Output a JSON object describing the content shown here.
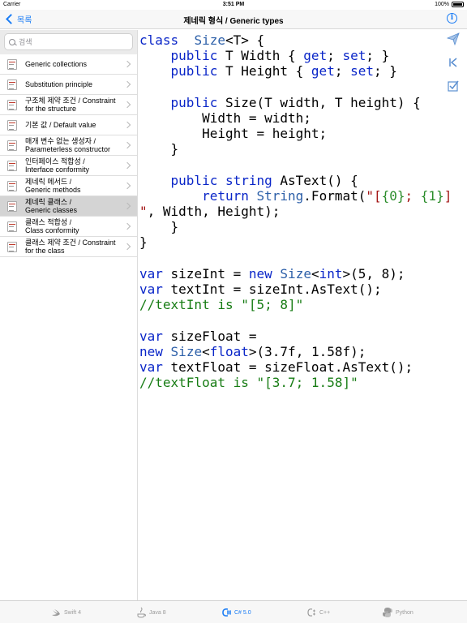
{
  "status": {
    "carrier": "Carrier",
    "time": "3:51 PM",
    "battery": "100%"
  },
  "nav": {
    "back_label": "목록",
    "title": "제네릭 형식 / Generic types",
    "info_glyph": "i"
  },
  "search": {
    "placeholder": "검색"
  },
  "sidebar": {
    "items": [
      {
        "line1": "Generic collections",
        "line2": ""
      },
      {
        "line1": "Substitution principle",
        "line2": ""
      },
      {
        "line1": "구조체 제약 조건 / Constraint",
        "line2": "for the structure"
      },
      {
        "line1": "기본 값 / Default value",
        "line2": ""
      },
      {
        "line1": "매개 변수 없는 생성자 /",
        "line2": "Parameterless constructor"
      },
      {
        "line1": "인터페이스 적합성 /",
        "line2": "Interface conformity"
      },
      {
        "line1": "제네릭 메서드 /",
        "line2": "Generic methods"
      },
      {
        "line1": "제네릭 클래스 /",
        "line2": "Generic classes"
      },
      {
        "line1": "클래스 적합성 /",
        "line2": "Class conformity"
      },
      {
        "line1": "클래스 제약 조건 / Constraint",
        "line2": "for the class"
      }
    ],
    "selected_index": 7
  },
  "code": {
    "lines": [
      [
        [
          "kw",
          "class"
        ],
        [
          "",
          "  "
        ],
        [
          "ty",
          "Size"
        ],
        [
          "",
          "<T> {"
        ]
      ],
      [
        [
          "",
          "    "
        ],
        [
          "kw",
          "public"
        ],
        [
          "",
          " T Width { "
        ],
        [
          "kw",
          "get"
        ],
        [
          "",
          "; "
        ],
        [
          "kw",
          "set"
        ],
        [
          "",
          "; }"
        ]
      ],
      [
        [
          "",
          "    "
        ],
        [
          "kw",
          "public"
        ],
        [
          "",
          " T Height { "
        ],
        [
          "kw",
          "get"
        ],
        [
          "",
          "; "
        ],
        [
          "kw",
          "set"
        ],
        [
          "",
          "; }"
        ]
      ],
      [
        [
          "",
          ""
        ]
      ],
      [
        [
          "",
          "    "
        ],
        [
          "kw",
          "public"
        ],
        [
          "",
          " Size(T width, T height) {"
        ]
      ],
      [
        [
          "",
          "        Width = width;"
        ]
      ],
      [
        [
          "",
          "        Height = height;"
        ]
      ],
      [
        [
          "",
          "    }"
        ]
      ],
      [
        [
          "",
          ""
        ]
      ],
      [
        [
          "",
          "    "
        ],
        [
          "kw",
          "public"
        ],
        [
          "",
          " "
        ],
        [
          "kw",
          "string"
        ],
        [
          "",
          " AsText() {"
        ]
      ],
      [
        [
          "",
          "        "
        ],
        [
          "kw",
          "return"
        ],
        [
          "",
          " "
        ],
        [
          "ty",
          "String"
        ],
        [
          "",
          ".Format("
        ],
        [
          "str",
          "\"["
        ],
        [
          "fmt",
          "{0}"
        ],
        [
          "str",
          "; "
        ],
        [
          "fmt",
          "{1}"
        ],
        [
          "str",
          "]"
        ]
      ],
      [
        [
          "str",
          "\""
        ],
        [
          "",
          ", Width, Height);"
        ]
      ],
      [
        [
          "",
          "    }"
        ]
      ],
      [
        [
          "",
          "}"
        ]
      ],
      [
        [
          "",
          ""
        ]
      ],
      [
        [
          "kw",
          "var"
        ],
        [
          "",
          " sizeInt = "
        ],
        [
          "kw",
          "new"
        ],
        [
          "",
          " "
        ],
        [
          "ty",
          "Size"
        ],
        [
          "",
          "<"
        ],
        [
          "kw",
          "int"
        ],
        [
          "",
          ">(5, 8);"
        ]
      ],
      [
        [
          "kw",
          "var"
        ],
        [
          "",
          " textInt = sizeInt.AsText();"
        ]
      ],
      [
        [
          "cm",
          "//textInt is \"[5; 8]\""
        ]
      ],
      [
        [
          "",
          ""
        ]
      ],
      [
        [
          "kw",
          "var"
        ],
        [
          "",
          " sizeFloat ="
        ]
      ],
      [
        [
          "kw",
          "new"
        ],
        [
          "",
          " "
        ],
        [
          "ty",
          "Size"
        ],
        [
          "",
          "<"
        ],
        [
          "kw",
          "float"
        ],
        [
          "",
          ">(3.7f, 1.58f);"
        ]
      ],
      [
        [
          "kw",
          "var"
        ],
        [
          "",
          " textFloat = sizeFloat.AsText();"
        ]
      ],
      [
        [
          "cm",
          "//textFloat is \"[3.7; 1.58]\""
        ]
      ]
    ]
  },
  "tools": [
    "send-icon",
    "first-icon",
    "checklist-icon"
  ],
  "tabs": [
    {
      "label": "Swift 4",
      "icon": "swift-icon",
      "active": false
    },
    {
      "label": "Java 8",
      "icon": "java-icon",
      "active": false
    },
    {
      "label": "C# 5.0",
      "icon": "csharp-icon",
      "active": true
    },
    {
      "label": "C++",
      "icon": "cpp-icon",
      "active": false
    },
    {
      "label": "Python",
      "icon": "python-icon",
      "active": false
    }
  ],
  "colors": {
    "accent": "#1a7cf5",
    "keyword": "#0a26c8",
    "type": "#2c5fa8",
    "string": "#a31515",
    "comment": "#177c14",
    "selected_row": "#d4d4d4"
  }
}
